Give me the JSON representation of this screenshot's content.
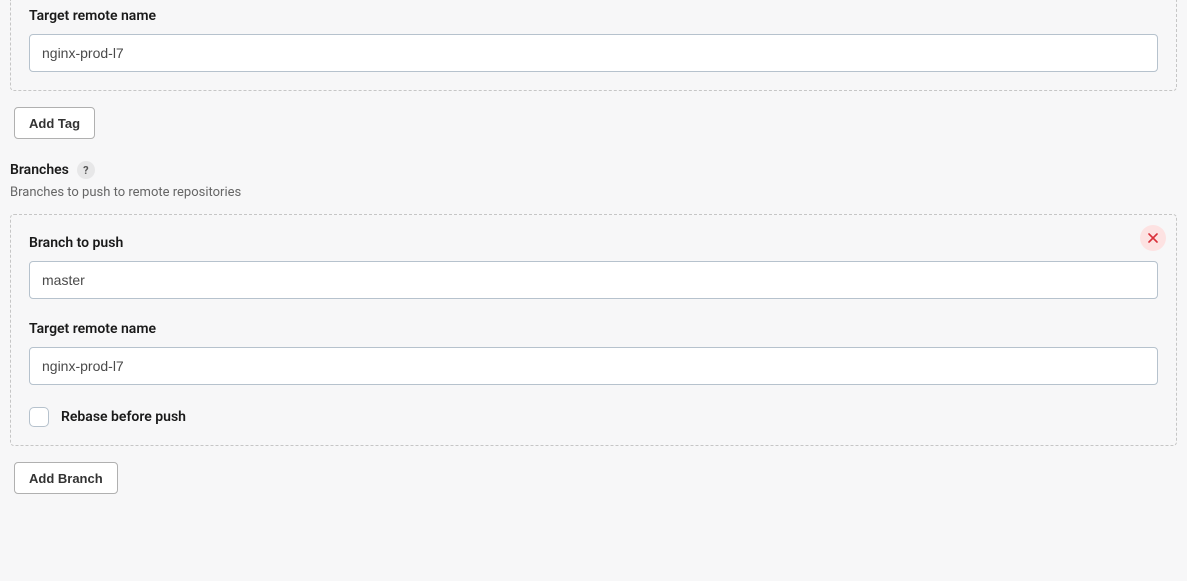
{
  "tag_group": {
    "target_remote_label": "Target remote name",
    "target_remote_value": "nginx-prod-l7"
  },
  "add_tag_button": "Add Tag",
  "branches_section": {
    "title": "Branches",
    "help_glyph": "?",
    "description": "Branches to push to remote repositories"
  },
  "branch_group": {
    "branch_label": "Branch to push",
    "branch_value": "master",
    "target_remote_label": "Target remote name",
    "target_remote_value": "nginx-prod-l7",
    "rebase_label": "Rebase before push"
  },
  "add_branch_button": "Add Branch"
}
